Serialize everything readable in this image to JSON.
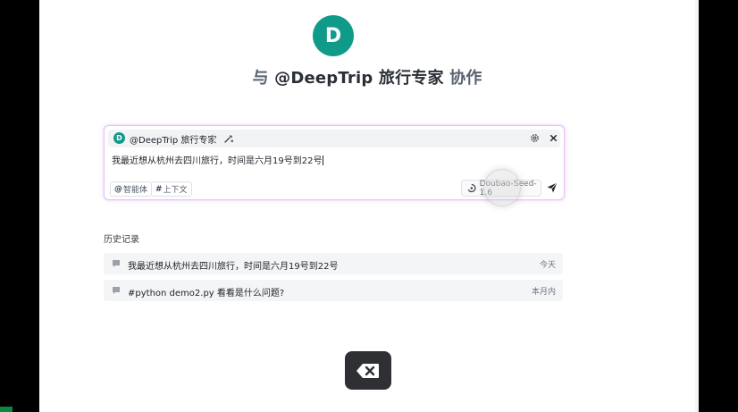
{
  "agent": {
    "avatar_letter": "D",
    "badge_letter": "D",
    "hero_prefix": "与",
    "hero_name": "@DeepTrip 旅行专家",
    "hero_suffix": "协作",
    "tag_name": "@DeepTrip 旅行专家",
    "brand_color": "#109a8a"
  },
  "composer": {
    "input_value": "我最近想从杭州去四川旅行，时间是六月19号到22号",
    "agent_chip_symbol": "@",
    "agent_chip_label": "智能体",
    "context_chip_symbol": "#",
    "context_chip_label": "上下文",
    "model_name": "Doubao-Seed-1.6",
    "icons": [
      "tool-icon",
      "gear-icon",
      "close-icon",
      "send-icon"
    ]
  },
  "history": {
    "title": "历史记录",
    "items": [
      {
        "text": "我最近想从杭州去四川旅行，时间是六月19号到22号",
        "time": "今天"
      },
      {
        "text": "#python demo2.py 看看是什么问题?",
        "time": "本月内"
      }
    ]
  },
  "overlay": {
    "key_icon": "backspace-icon"
  }
}
